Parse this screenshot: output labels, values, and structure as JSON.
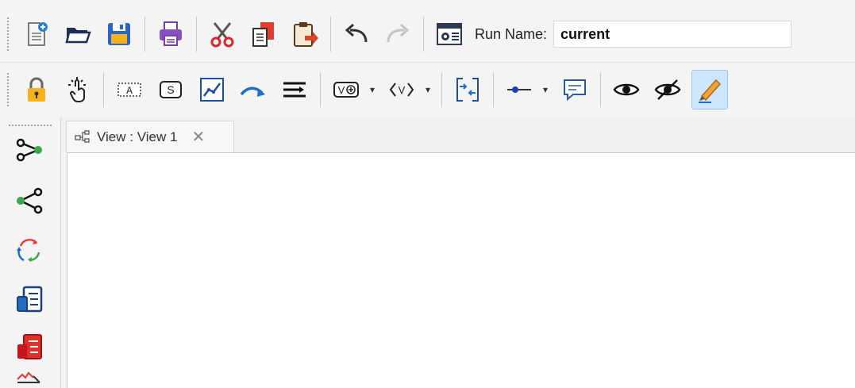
{
  "toolbar1": {
    "buttons": [
      {
        "name": "new-document",
        "icon": "new-document-icon"
      },
      {
        "name": "open-folder",
        "icon": "open-folder-icon"
      },
      {
        "name": "save",
        "icon": "save-icon"
      },
      {
        "name": "print",
        "icon": "print-icon"
      },
      {
        "name": "cut",
        "icon": "scissors-icon"
      },
      {
        "name": "copy",
        "icon": "copy-icon"
      },
      {
        "name": "paste",
        "icon": "clipboard-paste-icon"
      },
      {
        "name": "undo",
        "icon": "undo-arrow-icon"
      },
      {
        "name": "redo",
        "icon": "redo-arrow-icon"
      },
      {
        "name": "run-settings",
        "icon": "run-settings-window-icon"
      }
    ],
    "run_name": {
      "label": "Run Name:",
      "value": "current"
    }
  },
  "toolbar2": {
    "buttons": [
      {
        "name": "lock",
        "icon": "padlock-icon"
      },
      {
        "name": "pointer-hand",
        "icon": "hand-pointer-icon"
      },
      {
        "name": "text-a",
        "icon": "text-box-a-icon",
        "text": "A"
      },
      {
        "name": "stock-s",
        "icon": "stock-s-icon",
        "text": "S"
      },
      {
        "name": "graph",
        "icon": "line-graph-icon"
      },
      {
        "name": "flow-arrow",
        "icon": "curved-arrow-icon"
      },
      {
        "name": "align",
        "icon": "align-lines-icon"
      },
      {
        "name": "variable-add",
        "icon": "variable-add-icon",
        "text": "V"
      },
      {
        "name": "variable-tag",
        "icon": "variable-angle-icon",
        "text": "‹V›"
      },
      {
        "name": "collapse-expand",
        "icon": "collapse-arrows-icon"
      },
      {
        "name": "slider",
        "icon": "slider-icon"
      },
      {
        "name": "comment",
        "icon": "comment-bubble-icon"
      },
      {
        "name": "show",
        "icon": "eye-icon"
      },
      {
        "name": "hide",
        "icon": "eye-crossed-icon"
      },
      {
        "name": "edit",
        "icon": "pencil-icon"
      }
    ]
  },
  "left_palette": {
    "items": [
      {
        "name": "forward-tree",
        "icon": "tree-forward-icon"
      },
      {
        "name": "backward-tree",
        "icon": "tree-backward-icon"
      },
      {
        "name": "loops",
        "icon": "cycle-arrows-icon"
      },
      {
        "name": "document-blue",
        "icon": "document-blue-icon"
      },
      {
        "name": "document-red",
        "icon": "document-red-icon"
      },
      {
        "name": "chart-partial",
        "icon": "chart-icon"
      }
    ]
  },
  "tab": {
    "label": "View : View 1",
    "close": "✕",
    "icon": "view-diagram-icon"
  },
  "colors": {
    "accent_orange": "#e88a1a",
    "accent_blue": "#1f6fc5",
    "active_blue": "#cfe6ff"
  }
}
